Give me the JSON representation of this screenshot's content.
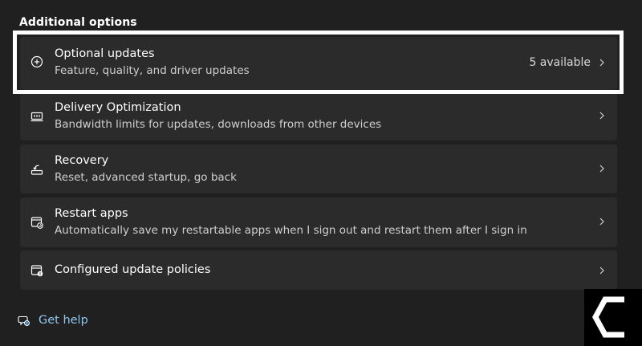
{
  "section": {
    "title": "Additional options"
  },
  "options": [
    {
      "title": "Optional updates",
      "description": "Feature, quality, and driver updates",
      "status": "5 available",
      "icon": "plus-circle-icon"
    },
    {
      "title": "Delivery Optimization",
      "description": "Bandwidth limits for updates, downloads from other devices",
      "icon": "delivery-optimization-icon"
    },
    {
      "title": "Recovery",
      "description": "Reset, advanced startup, go back",
      "icon": "recovery-icon"
    },
    {
      "title": "Restart apps",
      "description": "Automatically save my restartable apps when I sign out and restart them after I sign in",
      "icon": "restart-apps-icon"
    },
    {
      "title": "Configured update policies",
      "icon": "update-policies-icon"
    }
  ],
  "help": {
    "label": "Get help",
    "icon": "get-help-icon"
  },
  "colors": {
    "background": "#202020",
    "card": "#2b2b2b",
    "link": "#8fc6f0",
    "highlight": "#ffffff"
  }
}
